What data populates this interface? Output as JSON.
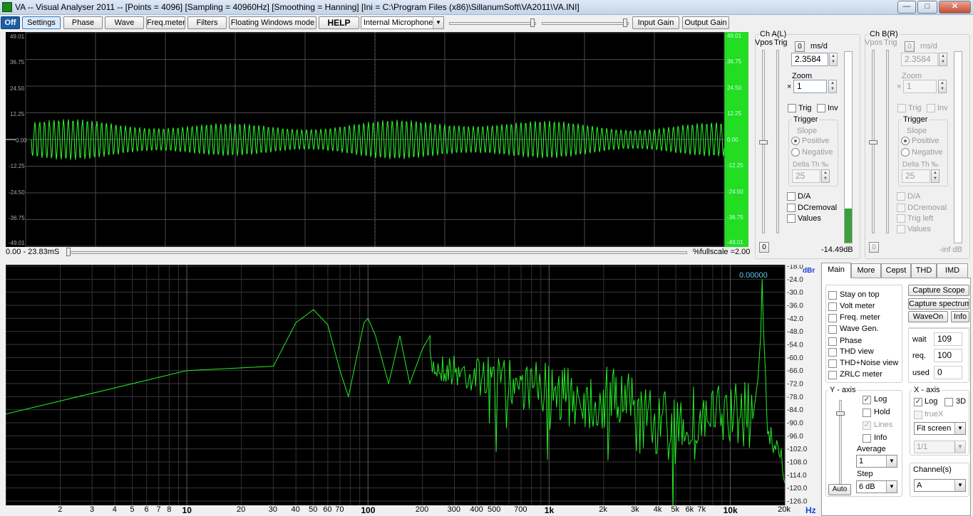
{
  "titlebar": {
    "title": "VA -- Visual Analyser 2011 --  [Points = 4096]  [Sampling = 40960Hz]  [Smoothing = Hanning]  [Ini = C:\\Program Files (x86)\\SillanumSoft\\VA2011\\VA.INI]",
    "minimize": "—",
    "maximize": "□",
    "close": "✕"
  },
  "toolbar": {
    "off": "Off",
    "settings": "Settings",
    "phase": "Phase",
    "wave": "Wave",
    "freqmeter": "Freq.meter",
    "filters": "Filters",
    "floating": "Floating Windows mode",
    "help": "HELP",
    "input_device": "Internal Microphone",
    "input_gain": "Input Gain",
    "output_gain": "Output Gain"
  },
  "scope": {
    "left_ticks": [
      "49.01",
      "36.75",
      "24.50",
      "12.25",
      "0.00",
      "-12.25",
      "-24.50",
      "-36.75",
      "-49.01"
    ],
    "right_ticks": [
      "49.01",
      "36.75",
      "24.50",
      "12.25",
      "0.00",
      "-12.25",
      "-24.50",
      "-36.75",
      "-49.01"
    ],
    "time_range": "0.00 - 23.83mS",
    "fullscale": "%fullscale =2.00"
  },
  "channel_a": {
    "title": "Ch A(L)",
    "vpos": "Vpos",
    "trig": "Trig",
    "zero_btn": "0",
    "msd_label": "ms/d",
    "msd_value": "2.3584",
    "zoom_label": "Zoom",
    "zoom_x": "×",
    "zoom_value": "1",
    "trig_chk": "Trig",
    "inv_chk": "Inv",
    "trigger_group": "Trigger",
    "slope": "Slope",
    "positive": "Positive",
    "negative": "Negative",
    "delta_th": "Delta Th ‰",
    "delta_value": "25",
    "da": "D/A",
    "dcremoval": "DCremoval",
    "values": "Values",
    "bottom_zero": "0",
    "level": "-14.49dB",
    "meter_level": 0.18
  },
  "channel_b": {
    "title": "Ch B(R)",
    "vpos": "Vpos",
    "trig": "Trig",
    "zero_btn": "0",
    "msd_label": "ms/d",
    "msd_value": "2.3584",
    "zoom_label": "Zoom",
    "zoom_x": "×",
    "zoom_value": "1",
    "trig_chk": "Trig",
    "inv_chk": "Inv",
    "trigger_group": "Trigger",
    "slope": "Slope",
    "positive": "Positive",
    "negative": "Negative",
    "delta_th": "Delta Th ‰",
    "delta_value": "25",
    "da": "D/A",
    "dcremoval": "DCremoval",
    "trig_left": "Trig left",
    "values": "Values",
    "bottom_zero": "0",
    "level": "-inf dB"
  },
  "spectrum": {
    "unit_top": "dBr",
    "unit_hz": "Hz",
    "peak_readout": "0.00000",
    "y_ticks": [
      "-18.0",
      "-24.0",
      "-30.0",
      "-36.0",
      "-42.0",
      "-48.0",
      "-54.0",
      "-60.0",
      "-66.0",
      "-72.0",
      "-78.0",
      "-84.0",
      "-90.0",
      "-96.0",
      "-102.0",
      "-108.0",
      "-114.0",
      "-120.0",
      "-126.0"
    ],
    "x_ticks": [
      {
        "f": 2,
        "t": "2"
      },
      {
        "f": 3,
        "t": "3"
      },
      {
        "f": 4,
        "t": "4"
      },
      {
        "f": 5,
        "t": "5"
      },
      {
        "f": 6,
        "t": "6"
      },
      {
        "f": 7,
        "t": "7"
      },
      {
        "f": 8,
        "t": "8"
      },
      {
        "f": 10,
        "t": "10",
        "b": true
      },
      {
        "f": 20,
        "t": "20"
      },
      {
        "f": 30,
        "t": "30"
      },
      {
        "f": 40,
        "t": "40"
      },
      {
        "f": 50,
        "t": "50"
      },
      {
        "f": 60,
        "t": "60"
      },
      {
        "f": 70,
        "t": "70"
      },
      {
        "f": 100,
        "t": "100",
        "b": true
      },
      {
        "f": 200,
        "t": "200"
      },
      {
        "f": 300,
        "t": "300"
      },
      {
        "f": 400,
        "t": "400"
      },
      {
        "f": 500,
        "t": "500"
      },
      {
        "f": 700,
        "t": "700"
      },
      {
        "f": 1000,
        "t": "1k",
        "b": true
      },
      {
        "f": 2000,
        "t": "2k"
      },
      {
        "f": 3000,
        "t": "3k"
      },
      {
        "f": 4000,
        "t": "4k"
      },
      {
        "f": 5000,
        "t": "5k"
      },
      {
        "f": 6000,
        "t": "6k"
      },
      {
        "f": 7000,
        "t": "7k"
      },
      {
        "f": 10000,
        "t": "10k",
        "b": true
      },
      {
        "f": 20000,
        "t": "20k"
      }
    ]
  },
  "right_panel": {
    "tabs": [
      "Main",
      "More",
      "Cepst",
      "THD",
      "IMD"
    ],
    "checks": [
      "Stay on top",
      "Volt meter",
      "Freq. meter",
      "Wave Gen.",
      "Phase",
      "THD view",
      "THD+Noise view",
      "ZRLC meter"
    ],
    "capture_scope": "Capture Scope",
    "capture_spectrum": "Capture spectrum",
    "waveon": "WaveOn",
    "info": "Info",
    "wait_label": "wait",
    "wait_value": "109",
    "req_label": "req.",
    "req_value": "100",
    "used_label": "used",
    "used_value": "0",
    "y_axis": "Y - axis",
    "y_log": "Log",
    "hold": "Hold",
    "lines": "Lines",
    "y_info": "Info",
    "average_label": "Average",
    "average_value": "1",
    "step_label": "Step",
    "step_value": "6 dB",
    "auto": "Auto",
    "x_axis": "X - axis",
    "x_log": "Log",
    "x_3d": "3D",
    "true_x": "trueX",
    "fit": "Fit screen",
    "ratio": "1/1",
    "channels_label": "Channel(s)",
    "channels_value": "A"
  }
}
